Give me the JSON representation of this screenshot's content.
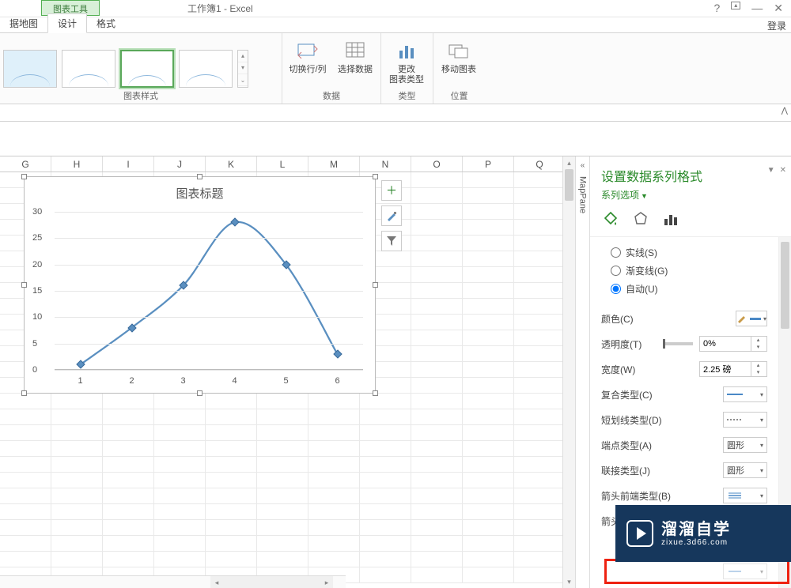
{
  "titlebar": {
    "tools_tab": "图表工具",
    "doc_title": "工作簿1 - Excel",
    "login": "登录"
  },
  "ribbon_tabs": {
    "tab_map": "据地图",
    "tab_design": "设计",
    "tab_format": "格式"
  },
  "ribbon": {
    "styles_label": "图表样式",
    "switch_rowcol": "切换行/列",
    "select_data": "选择数据",
    "data_label": "数据",
    "change_type_l1": "更改",
    "change_type_l2": "图表类型",
    "type_label": "类型",
    "move_chart": "移动图表",
    "location_label": "位置"
  },
  "columns": [
    "G",
    "H",
    "I",
    "J",
    "K",
    "L",
    "M",
    "N",
    "O",
    "P",
    "Q"
  ],
  "chart_side": {
    "plus": "＋"
  },
  "collapse_tab": {
    "text": "MapPane"
  },
  "pane": {
    "title": "设置数据系列格式",
    "series_options": "系列选项",
    "line_solid": "实线(S)",
    "line_gradient": "渐变线(G)",
    "line_auto": "自动(U)",
    "color": "颜色(C)",
    "transparency": "透明度(T)",
    "transparency_val": "0%",
    "width": "宽度(W)",
    "width_val": "2.25 磅",
    "compound": "复合类型(C)",
    "dash": "短划线类型(D)",
    "cap": "端点类型(A)",
    "cap_val": "圆形",
    "join": "联接类型(J)",
    "join_val": "圆形",
    "arrow_begin_type": "箭头前端类型(B)",
    "arrow_begin_size": "箭头前端大小(S)"
  },
  "watermark": {
    "brand": "溜溜自学",
    "url": "zixue.3d66.com"
  },
  "chart_data": {
    "type": "line",
    "title": "图表标题",
    "categories": [
      1,
      2,
      3,
      4,
      5,
      6
    ],
    "values": [
      1,
      8,
      16,
      28,
      20,
      3
    ],
    "ylim": [
      0,
      30
    ],
    "yticks": [
      0,
      5,
      10,
      15,
      20,
      25,
      30
    ]
  }
}
